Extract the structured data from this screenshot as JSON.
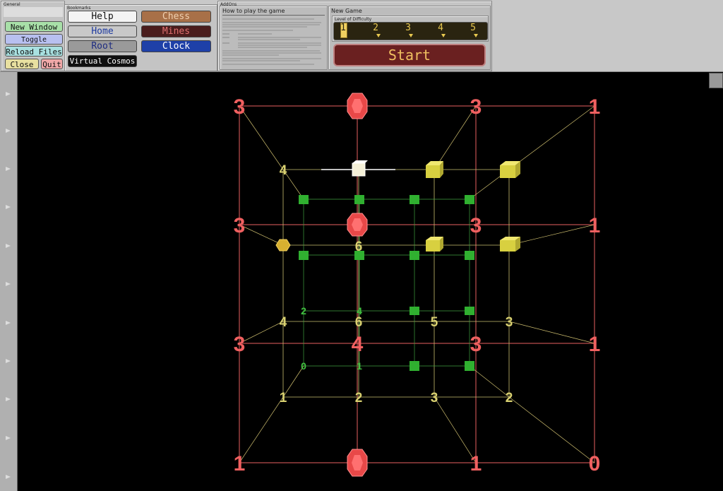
{
  "toolbar": {
    "general_title": "General",
    "bookmarks_title": "Bookmarks",
    "addons_title": "AddOns",
    "left_buttons": [
      "New Window",
      "Toggle Fullscreen",
      "Reload Files"
    ],
    "close_label": "Close",
    "quit_label": "Quit",
    "bookmarks": [
      {
        "label": "Help",
        "bg": "#f4f4f4",
        "fg": "#111"
      },
      {
        "label": "Chess",
        "bg": "#a87048",
        "fg": "#f0d0b0"
      },
      {
        "label": "Home",
        "bg": "#c8c8c8",
        "fg": "#1e3aa0"
      },
      {
        "label": "Mines",
        "bg": "#4a1c1c",
        "fg": "#e07070"
      },
      {
        "label": "Root",
        "bg": "#9a9a9a",
        "fg": "#1e2c80"
      },
      {
        "label": "Clock",
        "bg": "#1e40a8",
        "fg": "#ffffff"
      },
      {
        "label": "Virtual Cosmos",
        "bg": "#101010",
        "fg": "#ffffff"
      }
    ]
  },
  "howto": {
    "title": "How to play the game"
  },
  "newgame": {
    "title": "New Game",
    "level_label": "Level of Difficulty",
    "levels": [
      "1",
      "2",
      "3",
      "4",
      "5"
    ],
    "selected_level": 1,
    "start_label": "Start"
  },
  "colors": {
    "red": "#f06060",
    "yellow": "#d8d070",
    "green": "#40c040",
    "cube_yellow": "#e8e050",
    "cube_green": "#30b030"
  },
  "board": {
    "outer_numbers": [
      "3",
      "3",
      "1",
      "3",
      "3",
      "1",
      "3",
      "4",
      "3",
      "1",
      "1",
      "1",
      "0"
    ],
    "mid_numbers": [
      "4",
      "6",
      "4",
      "6",
      "5",
      "3",
      "1",
      "2",
      "3",
      "2"
    ],
    "inner_numbers": [
      "2",
      "4",
      "0",
      "1"
    ]
  }
}
